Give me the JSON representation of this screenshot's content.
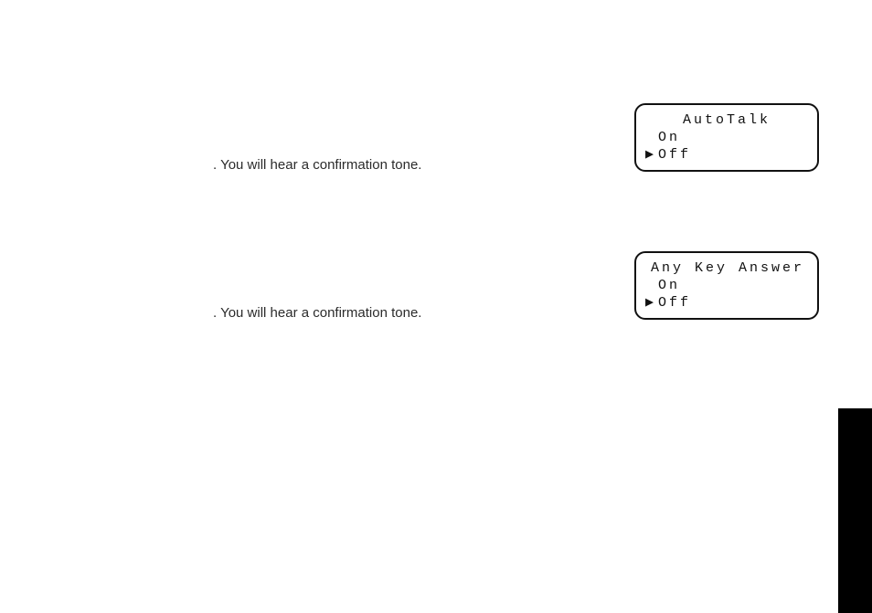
{
  "text": {
    "line1": ". You will hear a confirmation tone.",
    "line2": ". You will hear a confirmation tone."
  },
  "lcd1": {
    "title": "AutoTalk",
    "option1": "On",
    "option2": "Off",
    "cursor_on_row": 2
  },
  "lcd2": {
    "title": "Any Key Answer",
    "option1": "On",
    "option2": "Off",
    "cursor_on_row": 2
  },
  "glyphs": {
    "cursor": "▶",
    "blank": " "
  }
}
